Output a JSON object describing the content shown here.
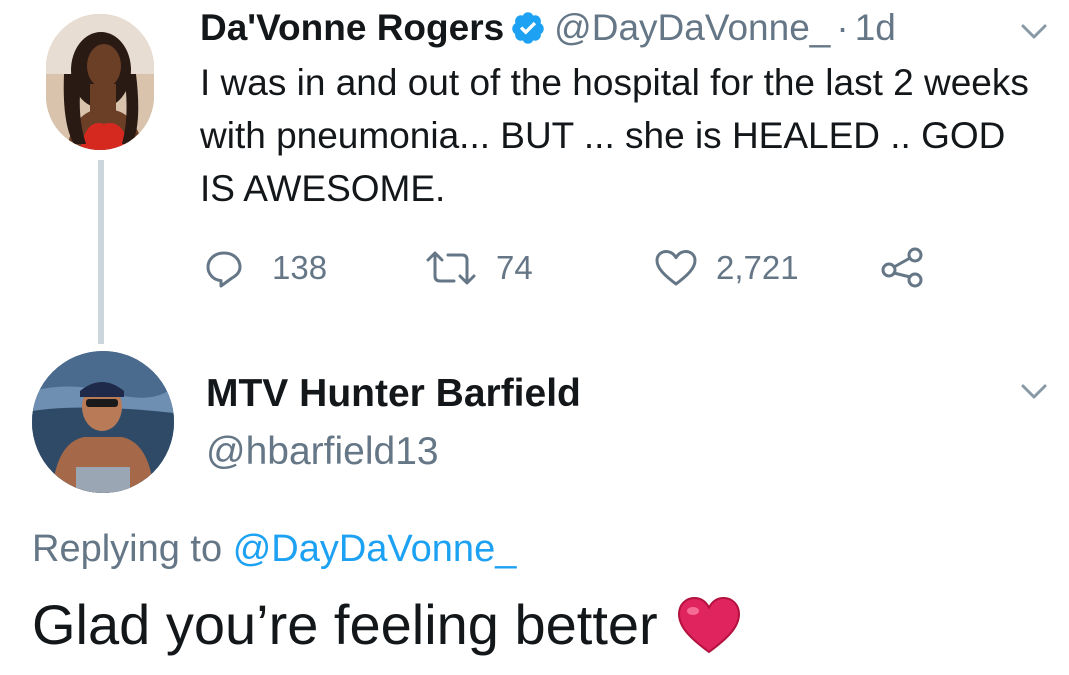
{
  "tweet": {
    "author": {
      "display_name": "Da'Vonne Rogers",
      "verified": true,
      "handle": "@DayDaVonne_",
      "separator": "·",
      "time": "1d"
    },
    "text": "I was in and out of the hospital for the last 2 weeks with pneumonia... BUT ... she is HEALED .. GOD IS AWESOME.",
    "actions": {
      "reply_count": "138",
      "retweet_count": "74",
      "like_count": "2,721"
    },
    "icons": {
      "reply": "reply-icon",
      "retweet": "retweet-icon",
      "like": "heart-icon",
      "share": "share-icon",
      "menu": "chevron-down-icon",
      "verified": "verified-badge-icon"
    }
  },
  "reply": {
    "author": {
      "display_name": "MTV Hunter Barfield",
      "handle": "@hbarfield13"
    },
    "replying_to_label": "Replying to",
    "replying_to_handle": "@DayDaVonne_",
    "text": "Glad you’re feeling better",
    "emoji": "red-heart-emoji"
  },
  "colors": {
    "text": "#14171a",
    "secondary": "#657786",
    "accent": "#1da1f2",
    "thread_line": "#ccd6dd",
    "heart": "#e0245e"
  }
}
